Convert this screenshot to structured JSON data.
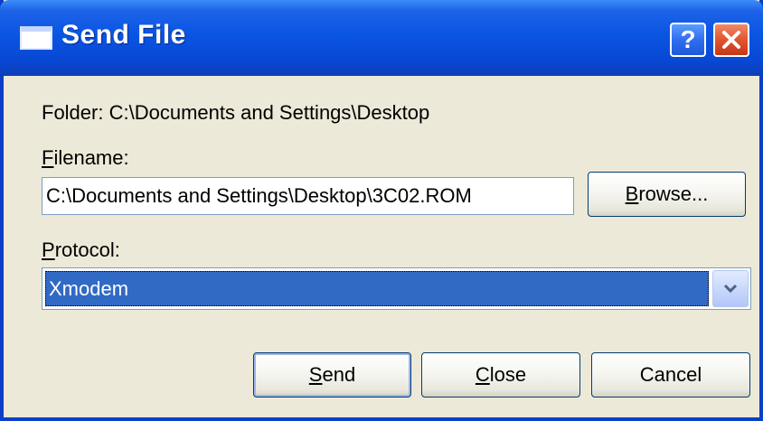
{
  "window": {
    "title": "Send File",
    "help_label": "?"
  },
  "folder": {
    "label": "Folder:",
    "value": "C:\\Documents and Settings\\Desktop"
  },
  "filename": {
    "label": "Filename:",
    "value": "C:\\Documents and Settings\\Desktop\\3C02.ROM",
    "browse_label": "Browse..."
  },
  "protocol": {
    "label": "Protocol:",
    "selected": "Xmodem"
  },
  "actions": {
    "send_label": "Send",
    "close_label": "Close",
    "cancel_label": "Cancel"
  },
  "colors": {
    "titlebar": "#0a55e3",
    "selection": "#316ac5",
    "close_button": "#e1552d"
  }
}
